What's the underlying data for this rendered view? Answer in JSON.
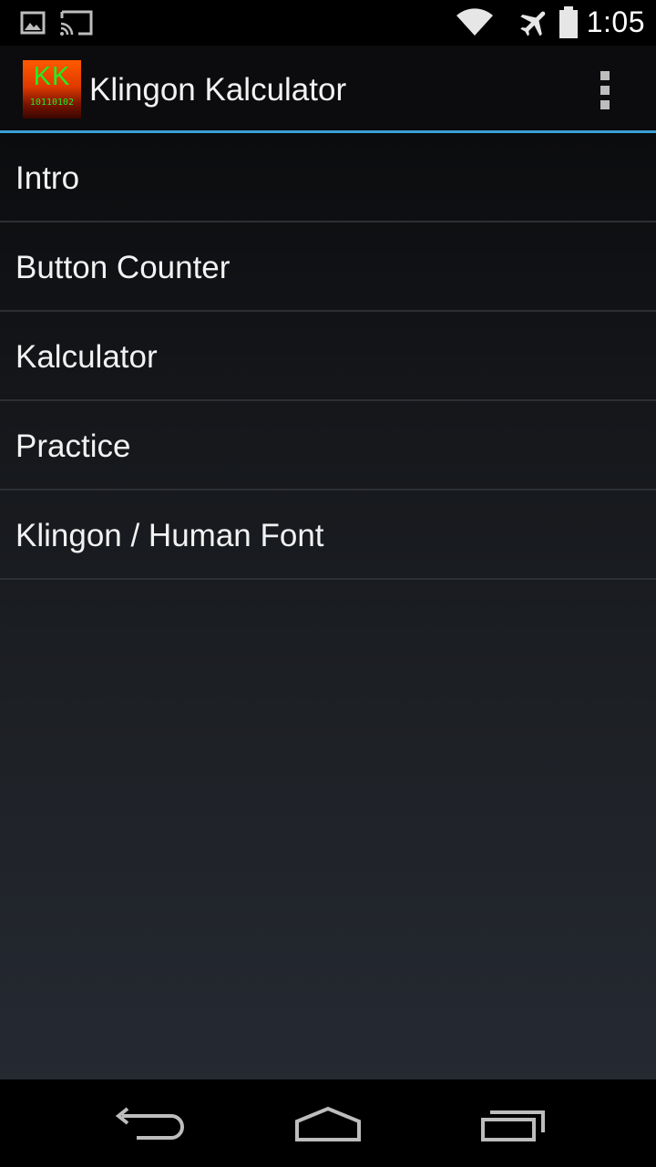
{
  "status_bar": {
    "time": "1:05",
    "icons": [
      "image-notification-icon",
      "cast-icon",
      "wifi-icon",
      "airplane-mode-icon",
      "battery-icon"
    ]
  },
  "action_bar": {
    "logo": {
      "letters": "KK",
      "digits": "10110102"
    },
    "title": "Klingon Kalculator",
    "overflow_icon": "overflow-menu-icon"
  },
  "menu": {
    "items": [
      {
        "label": "Intro"
      },
      {
        "label": "Button Counter"
      },
      {
        "label": "Kalculator"
      },
      {
        "label": "Practice"
      },
      {
        "label": "Klingon / Human Font"
      }
    ]
  },
  "nav_bar": {
    "icons": [
      "back-icon",
      "home-icon",
      "recent-apps-icon"
    ]
  },
  "colors": {
    "accent": "#3a9fd4",
    "logo_green": "#22ee22",
    "logo_orange": "#ff5a00"
  }
}
